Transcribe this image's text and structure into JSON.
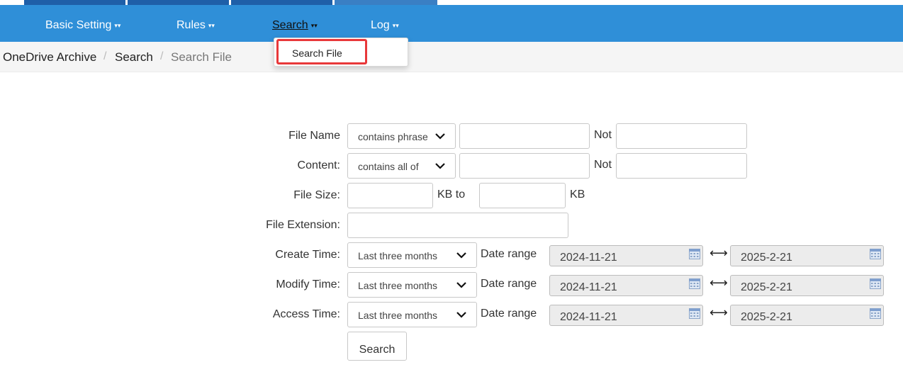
{
  "nav": {
    "items": [
      {
        "label": "Basic Setting"
      },
      {
        "label": "Rules"
      },
      {
        "label": "Search"
      },
      {
        "label": "Log"
      }
    ],
    "caret": "▾▾"
  },
  "breadcrumb": {
    "items": [
      "OneDrive Archive",
      "Search",
      "Search File"
    ],
    "separator": "/"
  },
  "dropdown": {
    "items": [
      "Search File"
    ]
  },
  "form": {
    "file_name": {
      "label": "File Name",
      "mode": "contains phrase",
      "value": "",
      "not_label": "Not",
      "not_value": ""
    },
    "content": {
      "label": "Content:",
      "mode": "contains all of",
      "value": "",
      "not_label": "Not",
      "not_value": ""
    },
    "file_size": {
      "label": "File Size:",
      "from": "",
      "to_label": "KB to",
      "to": "",
      "unit": "KB"
    },
    "file_extension": {
      "label": "File Extension:",
      "value": ""
    },
    "create_time": {
      "label": "Create Time:",
      "period": "Last three months",
      "range_label": "Date range",
      "start": "2024-11-21",
      "end": "2025-2-21"
    },
    "modify_time": {
      "label": "Modify Time:",
      "period": "Last three months",
      "range_label": "Date range",
      "start": "2024-11-21",
      "end": "2025-2-21"
    },
    "access_time": {
      "label": "Access Time:",
      "period": "Last three months",
      "range_label": "Date range",
      "start": "2024-11-21",
      "end": "2025-2-21"
    },
    "arrow": "⟷",
    "search_button": "Search"
  },
  "icons": {
    "chevron": "chevron-down-icon",
    "calendar": "calendar-icon"
  },
  "colors": {
    "navbar": "#2f8fd8",
    "tab": "#1f5fa8",
    "highlight": "#e8383a"
  }
}
